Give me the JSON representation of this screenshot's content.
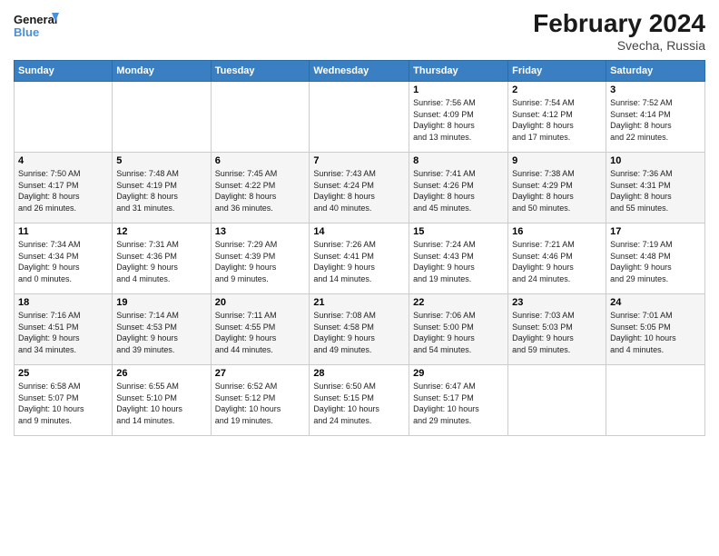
{
  "logo": {
    "line1": "General",
    "line2": "Blue"
  },
  "title": "February 2024",
  "subtitle": "Svecha, Russia",
  "days_header": [
    "Sunday",
    "Monday",
    "Tuesday",
    "Wednesday",
    "Thursday",
    "Friday",
    "Saturday"
  ],
  "weeks": [
    [
      {
        "day": "",
        "info": ""
      },
      {
        "day": "",
        "info": ""
      },
      {
        "day": "",
        "info": ""
      },
      {
        "day": "",
        "info": ""
      },
      {
        "day": "1",
        "info": "Sunrise: 7:56 AM\nSunset: 4:09 PM\nDaylight: 8 hours\nand 13 minutes."
      },
      {
        "day": "2",
        "info": "Sunrise: 7:54 AM\nSunset: 4:12 PM\nDaylight: 8 hours\nand 17 minutes."
      },
      {
        "day": "3",
        "info": "Sunrise: 7:52 AM\nSunset: 4:14 PM\nDaylight: 8 hours\nand 22 minutes."
      }
    ],
    [
      {
        "day": "4",
        "info": "Sunrise: 7:50 AM\nSunset: 4:17 PM\nDaylight: 8 hours\nand 26 minutes."
      },
      {
        "day": "5",
        "info": "Sunrise: 7:48 AM\nSunset: 4:19 PM\nDaylight: 8 hours\nand 31 minutes."
      },
      {
        "day": "6",
        "info": "Sunrise: 7:45 AM\nSunset: 4:22 PM\nDaylight: 8 hours\nand 36 minutes."
      },
      {
        "day": "7",
        "info": "Sunrise: 7:43 AM\nSunset: 4:24 PM\nDaylight: 8 hours\nand 40 minutes."
      },
      {
        "day": "8",
        "info": "Sunrise: 7:41 AM\nSunset: 4:26 PM\nDaylight: 8 hours\nand 45 minutes."
      },
      {
        "day": "9",
        "info": "Sunrise: 7:38 AM\nSunset: 4:29 PM\nDaylight: 8 hours\nand 50 minutes."
      },
      {
        "day": "10",
        "info": "Sunrise: 7:36 AM\nSunset: 4:31 PM\nDaylight: 8 hours\nand 55 minutes."
      }
    ],
    [
      {
        "day": "11",
        "info": "Sunrise: 7:34 AM\nSunset: 4:34 PM\nDaylight: 9 hours\nand 0 minutes."
      },
      {
        "day": "12",
        "info": "Sunrise: 7:31 AM\nSunset: 4:36 PM\nDaylight: 9 hours\nand 4 minutes."
      },
      {
        "day": "13",
        "info": "Sunrise: 7:29 AM\nSunset: 4:39 PM\nDaylight: 9 hours\nand 9 minutes."
      },
      {
        "day": "14",
        "info": "Sunrise: 7:26 AM\nSunset: 4:41 PM\nDaylight: 9 hours\nand 14 minutes."
      },
      {
        "day": "15",
        "info": "Sunrise: 7:24 AM\nSunset: 4:43 PM\nDaylight: 9 hours\nand 19 minutes."
      },
      {
        "day": "16",
        "info": "Sunrise: 7:21 AM\nSunset: 4:46 PM\nDaylight: 9 hours\nand 24 minutes."
      },
      {
        "day": "17",
        "info": "Sunrise: 7:19 AM\nSunset: 4:48 PM\nDaylight: 9 hours\nand 29 minutes."
      }
    ],
    [
      {
        "day": "18",
        "info": "Sunrise: 7:16 AM\nSunset: 4:51 PM\nDaylight: 9 hours\nand 34 minutes."
      },
      {
        "day": "19",
        "info": "Sunrise: 7:14 AM\nSunset: 4:53 PM\nDaylight: 9 hours\nand 39 minutes."
      },
      {
        "day": "20",
        "info": "Sunrise: 7:11 AM\nSunset: 4:55 PM\nDaylight: 9 hours\nand 44 minutes."
      },
      {
        "day": "21",
        "info": "Sunrise: 7:08 AM\nSunset: 4:58 PM\nDaylight: 9 hours\nand 49 minutes."
      },
      {
        "day": "22",
        "info": "Sunrise: 7:06 AM\nSunset: 5:00 PM\nDaylight: 9 hours\nand 54 minutes."
      },
      {
        "day": "23",
        "info": "Sunrise: 7:03 AM\nSunset: 5:03 PM\nDaylight: 9 hours\nand 59 minutes."
      },
      {
        "day": "24",
        "info": "Sunrise: 7:01 AM\nSunset: 5:05 PM\nDaylight: 10 hours\nand 4 minutes."
      }
    ],
    [
      {
        "day": "25",
        "info": "Sunrise: 6:58 AM\nSunset: 5:07 PM\nDaylight: 10 hours\nand 9 minutes."
      },
      {
        "day": "26",
        "info": "Sunrise: 6:55 AM\nSunset: 5:10 PM\nDaylight: 10 hours\nand 14 minutes."
      },
      {
        "day": "27",
        "info": "Sunrise: 6:52 AM\nSunset: 5:12 PM\nDaylight: 10 hours\nand 19 minutes."
      },
      {
        "day": "28",
        "info": "Sunrise: 6:50 AM\nSunset: 5:15 PM\nDaylight: 10 hours\nand 24 minutes."
      },
      {
        "day": "29",
        "info": "Sunrise: 6:47 AM\nSunset: 5:17 PM\nDaylight: 10 hours\nand 29 minutes."
      },
      {
        "day": "",
        "info": ""
      },
      {
        "day": "",
        "info": ""
      }
    ]
  ]
}
